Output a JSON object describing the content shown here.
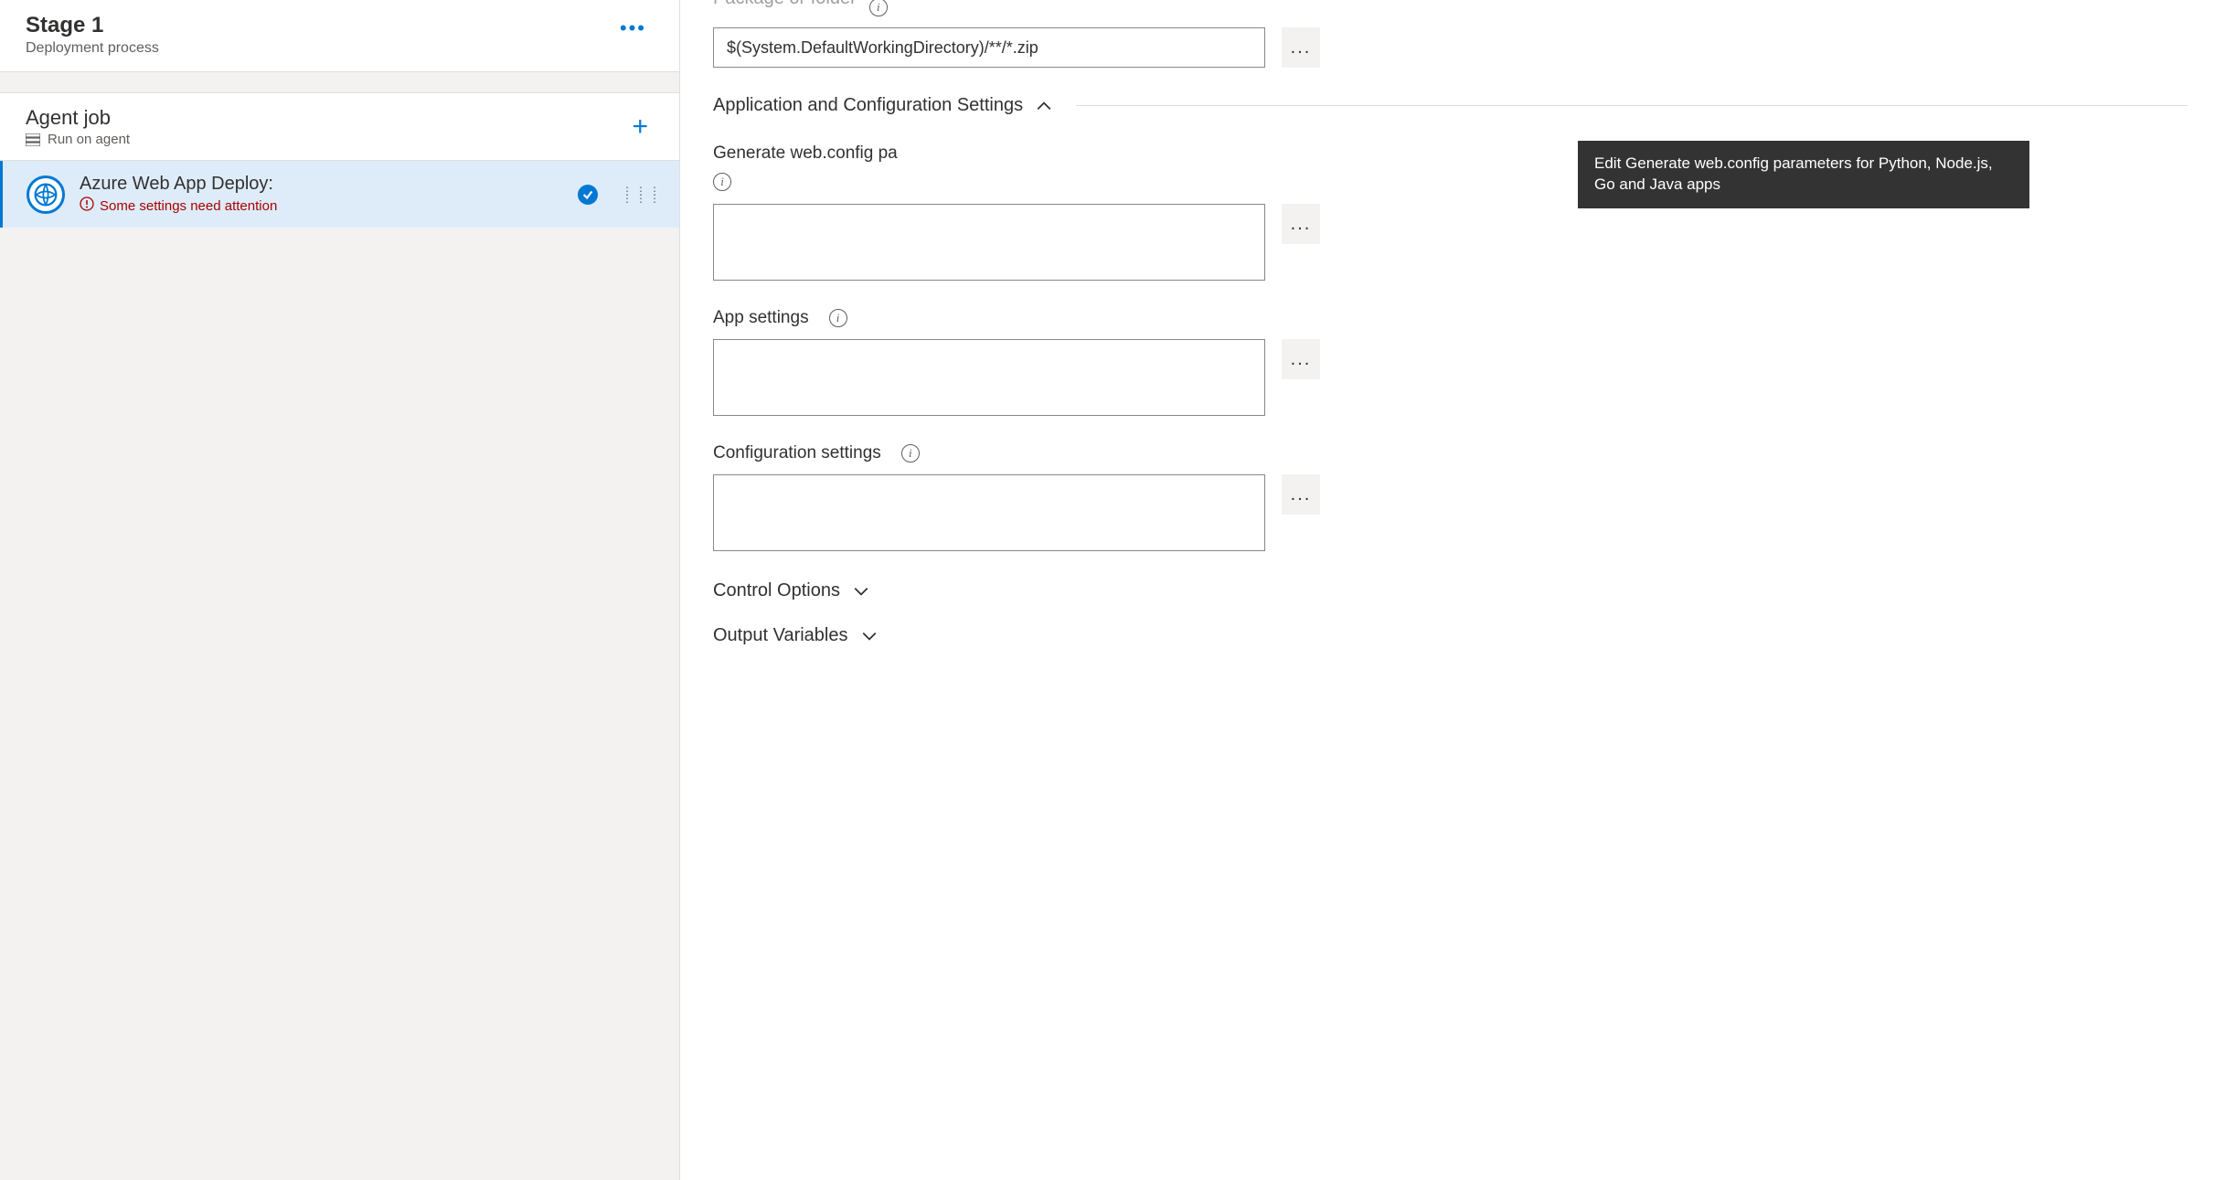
{
  "left": {
    "stage_title": "Stage 1",
    "stage_subtitle": "Deployment process",
    "agent_job_title": "Agent job",
    "agent_job_subtitle": "Run on agent",
    "task_title": "Azure Web App Deploy:",
    "task_warning": "Some settings need attention"
  },
  "right": {
    "package_label_partial": "Package or folder",
    "package_value": "$(System.DefaultWorkingDirectory)/**/*.zip",
    "section_app_config": "Application and Configuration Settings",
    "webconfig_label_visible": "Generate web.config pa",
    "app_settings_label": "App settings",
    "config_settings_label": "Configuration settings",
    "section_control": "Control Options",
    "section_output": "Output Variables",
    "webconfig_value": "",
    "app_settings_value": "",
    "config_settings_value": ""
  },
  "tooltip": {
    "text": "Edit Generate web.config parameters for Python, Node.js, Go and Java apps"
  }
}
